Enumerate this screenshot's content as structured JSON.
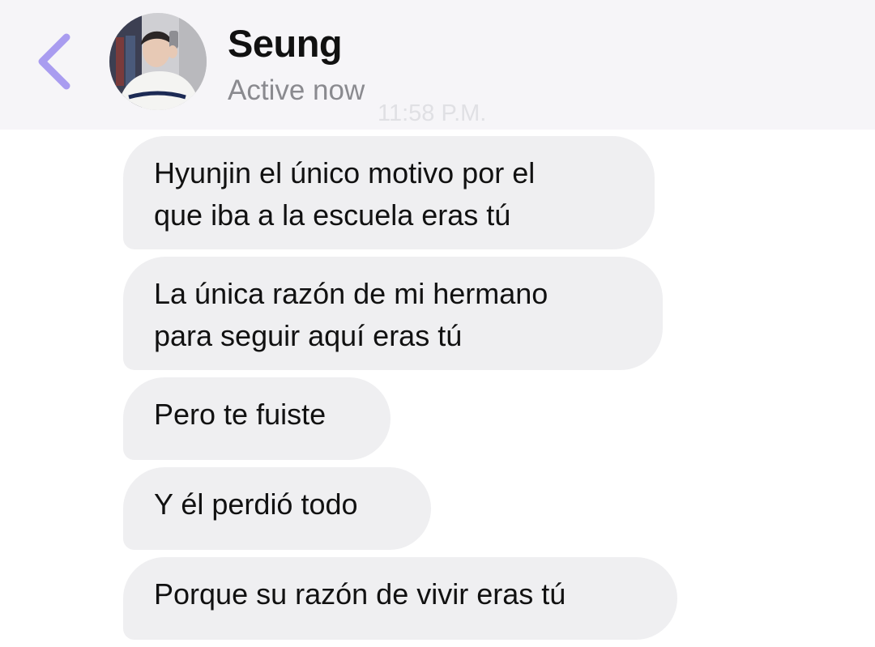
{
  "header": {
    "contact_name": "Seung",
    "status": "Active now",
    "back_icon": "chevron-left-icon",
    "accent_color": "#a99cf0"
  },
  "thread": {
    "timestamp": "11:58 P.M.",
    "messages": [
      {
        "lines": [
          "Hyunjin el único motivo por el",
          "que iba a la escuela eras tú"
        ]
      },
      {
        "lines": [
          "La única razón de mi hermano",
          "para seguir aquí eras tú"
        ]
      },
      {
        "lines": [
          "Pero te fuiste"
        ]
      },
      {
        "lines": [
          "Y él perdió todo"
        ]
      },
      {
        "lines": [
          "Porque su razón de vivir eras tú"
        ]
      }
    ]
  }
}
